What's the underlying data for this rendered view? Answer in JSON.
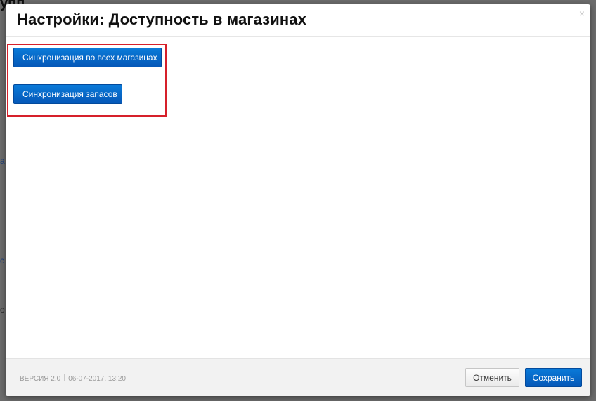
{
  "background": {
    "fragments": [
      "упп",
      "а",
      "с",
      "о"
    ]
  },
  "dialog": {
    "title": "Настройки: Доступность в магазинах",
    "close_glyph": "×"
  },
  "actions": {
    "sync_all_label": "Синхронизация во всех магазинах",
    "sync_stock_label": "Синхронизация запасов"
  },
  "footer": {
    "version": "ВЕРСИЯ 2.0",
    "timestamp": "06-07-2017, 13:20",
    "cancel_label": "Отменить",
    "save_label": "Сохранить"
  },
  "colors": {
    "primary_button": "#0667c8",
    "highlight_border": "#d6202a",
    "footer_bg": "#f2f2f2"
  }
}
